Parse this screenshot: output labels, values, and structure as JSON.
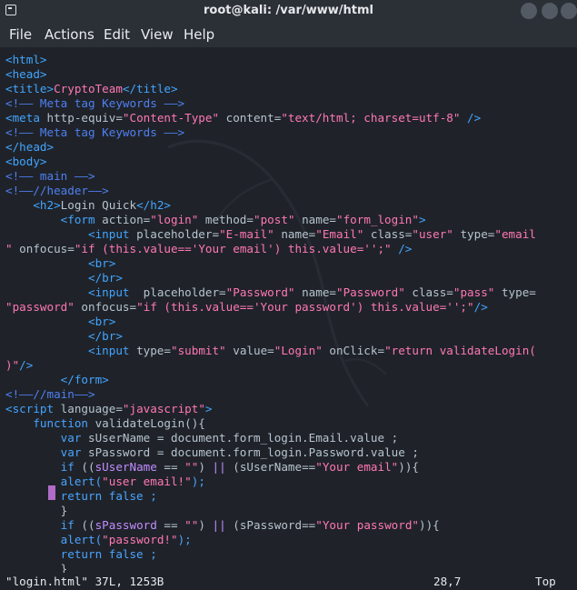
{
  "window": {
    "title": "root@kali: /var/www/html"
  },
  "menu": [
    "File",
    "Actions",
    "Edit",
    "View",
    "Help"
  ],
  "lines": [
    [
      {
        "t": "t",
        "v": "<html>"
      }
    ],
    [
      {
        "t": "t",
        "v": "<head>"
      }
    ],
    [
      {
        "t": "t",
        "v": "<title>"
      },
      {
        "t": "s",
        "v": "CryptoTeam"
      },
      {
        "t": "t",
        "v": "</title>"
      }
    ],
    [
      {
        "t": "c",
        "v": "<!—— Meta tag Keywords ——>"
      }
    ],
    [
      {
        "t": "t",
        "v": "<meta "
      },
      {
        "t": "a",
        "v": "http-equiv="
      },
      {
        "t": "s",
        "v": "\"Content-Type\""
      },
      {
        "t": "a",
        "v": " content="
      },
      {
        "t": "s",
        "v": "\"text/html; charset=utf-8\""
      },
      {
        "t": "t",
        "v": " />"
      }
    ],
    [
      {
        "t": "c",
        "v": "<!—— Meta tag Keywords ——>"
      }
    ],
    [
      {
        "t": "t",
        "v": "</head>"
      }
    ],
    [
      {
        "t": "t",
        "v": "<body>"
      }
    ],
    [
      {
        "t": "c",
        "v": "<!—— main ——>"
      }
    ],
    [
      {
        "t": "c",
        "v": "<!——//header——>"
      }
    ],
    [
      {
        "t": "t",
        "v": "    <h2>"
      },
      {
        "t": "a",
        "v": "Login Quick"
      },
      {
        "t": "t",
        "v": "</h2>"
      }
    ],
    [
      {
        "t": "t",
        "v": "        <form "
      },
      {
        "t": "a",
        "v": "action="
      },
      {
        "t": "s",
        "v": "\"login\""
      },
      {
        "t": "a",
        "v": " method="
      },
      {
        "t": "s",
        "v": "\"post\""
      },
      {
        "t": "a",
        "v": " name="
      },
      {
        "t": "s",
        "v": "\"form_login\""
      },
      {
        "t": "t",
        "v": ">"
      }
    ],
    [
      {
        "t": "t",
        "v": "            <input "
      },
      {
        "t": "a",
        "v": "placeholder="
      },
      {
        "t": "s",
        "v": "\"E-mail\""
      },
      {
        "t": "a",
        "v": " name="
      },
      {
        "t": "s",
        "v": "\"Email\""
      },
      {
        "t": "a",
        "v": " class="
      },
      {
        "t": "s",
        "v": "\"user\""
      },
      {
        "t": "a",
        "v": " type="
      },
      {
        "t": "s",
        "v": "\"email"
      }
    ],
    [
      {
        "t": "s",
        "v": "\""
      },
      {
        "t": "a",
        "v": " onfocus="
      },
      {
        "t": "s",
        "v": "\"if (this.value=='Your email') this.value='';\""
      },
      {
        "t": "t",
        "v": " />"
      }
    ],
    [
      {
        "t": "t",
        "v": "            <br>"
      }
    ],
    [
      {
        "t": "t",
        "v": "            </br>"
      }
    ],
    [
      {
        "t": "t",
        "v": "            <input  "
      },
      {
        "t": "a",
        "v": "placeholder="
      },
      {
        "t": "s",
        "v": "\"Password\""
      },
      {
        "t": "a",
        "v": " name="
      },
      {
        "t": "s",
        "v": "\"Password\""
      },
      {
        "t": "a",
        "v": " class="
      },
      {
        "t": "s",
        "v": "\"pass\""
      },
      {
        "t": "a",
        "v": " type="
      }
    ],
    [
      {
        "t": "s",
        "v": "\"password\""
      },
      {
        "t": "a",
        "v": " onfocus="
      },
      {
        "t": "s",
        "v": "\"if (this.value=='Your password') this.value='';\""
      },
      {
        "t": "t",
        "v": "/>"
      }
    ],
    [
      {
        "t": "t",
        "v": "            <br>"
      }
    ],
    [
      {
        "t": "t",
        "v": "            </br>"
      }
    ],
    [
      {
        "t": "t",
        "v": "            <input "
      },
      {
        "t": "a",
        "v": "type="
      },
      {
        "t": "s",
        "v": "\"submit\""
      },
      {
        "t": "a",
        "v": " value="
      },
      {
        "t": "s",
        "v": "\"Login\""
      },
      {
        "t": "a",
        "v": " onClick="
      },
      {
        "t": "s",
        "v": "\"return validateLogin("
      }
    ],
    [
      {
        "t": "s",
        "v": ")\""
      },
      {
        "t": "t",
        "v": "/>"
      }
    ],
    [
      {
        "t": "t",
        "v": "        </form>"
      }
    ],
    [
      {
        "t": "c",
        "v": "<!——//main——>"
      }
    ],
    [
      {
        "t": "t",
        "v": "<script "
      },
      {
        "t": "a",
        "v": "language="
      },
      {
        "t": "s",
        "v": "\"javascript\""
      },
      {
        "t": "t",
        "v": ">"
      }
    ],
    [
      {
        "t": "k",
        "v": "    function "
      },
      {
        "t": "a",
        "v": "validateLogin(){"
      }
    ],
    [
      {
        "t": "k",
        "v": "        var "
      },
      {
        "t": "a",
        "v": "sUserName = document.form_login.Email.value ;"
      }
    ],
    [
      {
        "t": "k",
        "v": "        var "
      },
      {
        "t": "a",
        "v": "sPassword = document.form_login.Password.value ;"
      }
    ],
    [
      {
        "t": "k",
        "v": "        if "
      },
      {
        "t": "a",
        "v": "(("
      },
      {
        "t": "p",
        "v": "sUserName"
      },
      {
        "t": "a",
        "v": " == "
      },
      {
        "t": "s",
        "v": "\"\""
      },
      {
        "t": "a",
        "v": ") "
      },
      {
        "t": "p",
        "v": "||"
      },
      {
        "t": "a",
        "v": " (sUserName=="
      },
      {
        "t": "s",
        "v": "\"Your email\""
      },
      {
        "t": "a",
        "v": ")){"
      }
    ],
    [
      {
        "t": "k",
        "v": "        alert("
      },
      {
        "t": "s",
        "v": "\"user email!\""
      },
      {
        "t": "k",
        "v": ");"
      }
    ],
    [
      {
        "t": "k",
        "v": "        return false ;"
      }
    ],
    [
      {
        "t": "a",
        "v": "        }"
      }
    ],
    [
      {
        "t": "k",
        "v": "        if "
      },
      {
        "t": "a",
        "v": "(("
      },
      {
        "t": "p",
        "v": "sPassword"
      },
      {
        "t": "a",
        "v": " == "
      },
      {
        "t": "s",
        "v": "\"\""
      },
      {
        "t": "a",
        "v": ") "
      },
      {
        "t": "p",
        "v": "||"
      },
      {
        "t": "a",
        "v": " (sPassword=="
      },
      {
        "t": "s",
        "v": "\"Your password\""
      },
      {
        "t": "a",
        "v": ")){"
      }
    ],
    [
      {
        "t": "k",
        "v": "        alert("
      },
      {
        "t": "s",
        "v": "\"password!\""
      },
      {
        "t": "k",
        "v": ");"
      }
    ],
    [
      {
        "t": "k",
        "v": "        return false ;"
      }
    ],
    [
      {
        "t": "a",
        "v": "        }"
      }
    ]
  ],
  "status": {
    "file": "\"login.html\" 37L, 1253B",
    "pos": "28,7",
    "scroll": "Top"
  }
}
